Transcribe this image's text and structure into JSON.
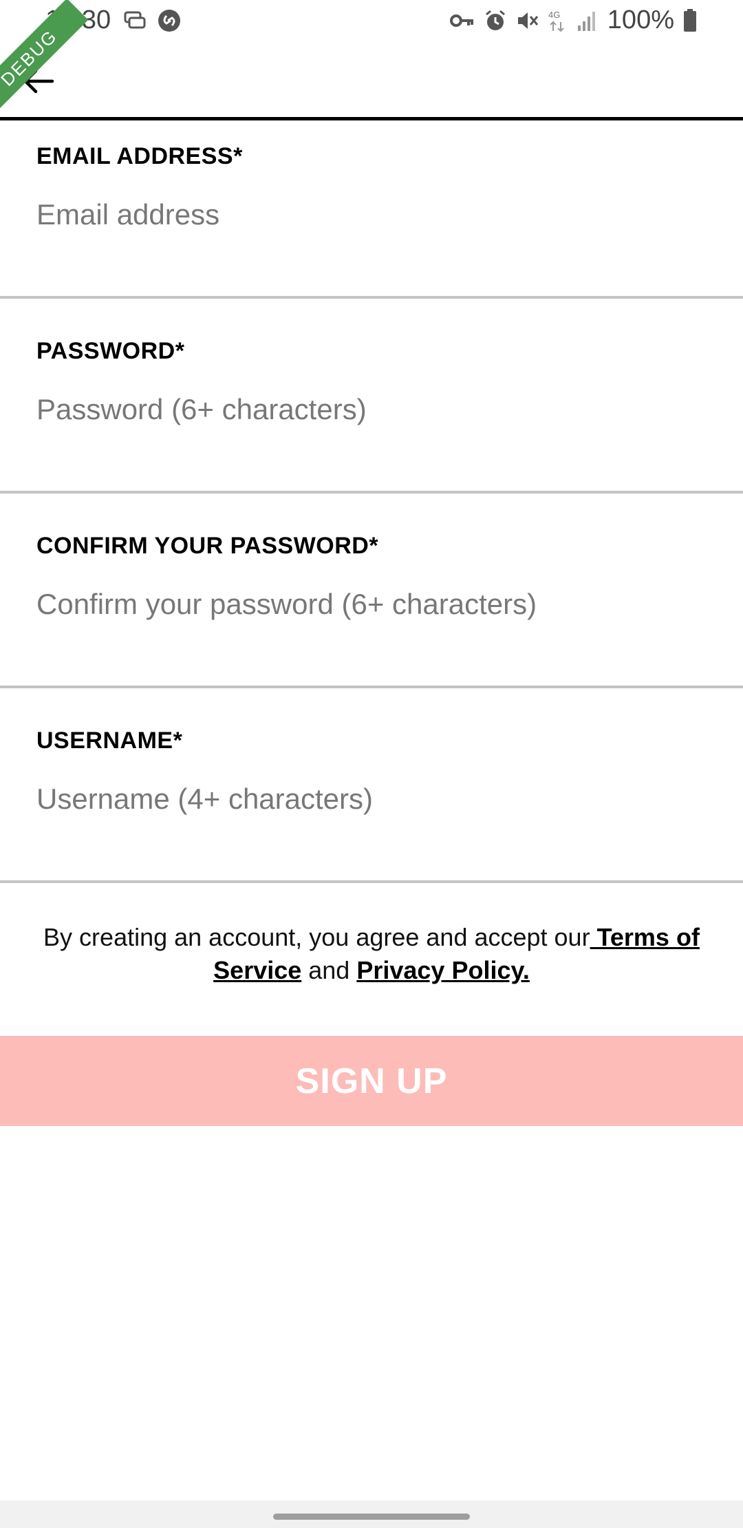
{
  "status_bar": {
    "time": "15:30",
    "battery": "100%",
    "network": "4G",
    "left_icons": [
      "chat-icon",
      "shazam-icon"
    ],
    "right_icons": [
      "vpn-key-icon",
      "alarm-icon",
      "mute-icon",
      "network-4g-icon",
      "signal-icon",
      "battery-icon"
    ]
  },
  "debug_banner": {
    "label": "DEBUG"
  },
  "app_bar": {
    "back_icon": "arrow-left-icon"
  },
  "form": {
    "email": {
      "label": "EMAIL ADDRESS*",
      "placeholder": "Email address",
      "value": ""
    },
    "password": {
      "label": "PASSWORD*",
      "placeholder": "Password (6+ characters)",
      "value": ""
    },
    "confirm_password": {
      "label": "CONFIRM YOUR PASSWORD*",
      "placeholder": "Confirm your password (6+ characters)",
      "value": ""
    },
    "username": {
      "label": "USERNAME*",
      "placeholder": "Username (4+ characters)",
      "value": ""
    }
  },
  "terms": {
    "prefix": "By creating an account, you agree and accept our",
    "terms_link": " Terms of Service",
    "middle": " and ",
    "privacy_link": "Privacy Policy."
  },
  "signup_button": {
    "label": "SIGN UP"
  },
  "colors": {
    "signup_bg": "#fdbcb8",
    "divider": "#c4c4c4",
    "debug_green": "#4a9a4f"
  }
}
